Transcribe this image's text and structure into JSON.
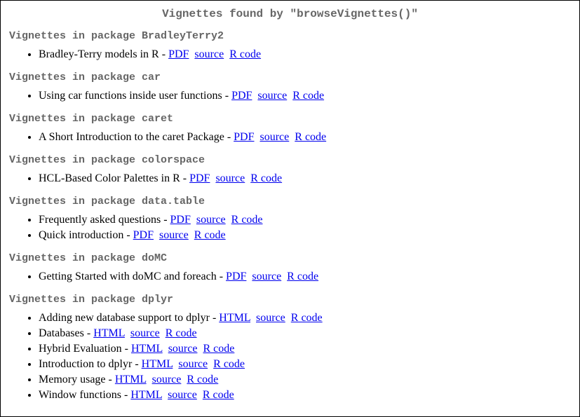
{
  "title": "Vignettes found by \"browseVignettes()\"",
  "heading_prefix": "Vignettes in package ",
  "dash": " - ",
  "link_spacer": "  ",
  "packages": [
    {
      "name": "BradleyTerry2",
      "vignettes": [
        {
          "title": "Bradley-Terry models in R",
          "links": [
            "PDF",
            "source",
            "R code"
          ]
        }
      ]
    },
    {
      "name": "car",
      "vignettes": [
        {
          "title": "Using car functions inside user functions",
          "links": [
            "PDF",
            "source",
            "R code"
          ]
        }
      ]
    },
    {
      "name": "caret",
      "vignettes": [
        {
          "title": "A Short Introduction to the caret Package",
          "links": [
            "PDF",
            "source",
            "R code"
          ]
        }
      ]
    },
    {
      "name": "colorspace",
      "vignettes": [
        {
          "title": "HCL-Based Color Palettes in R",
          "links": [
            "PDF",
            "source",
            "R code"
          ]
        }
      ]
    },
    {
      "name": "data.table",
      "vignettes": [
        {
          "title": "Frequently asked questions",
          "links": [
            "PDF",
            "source",
            "R code"
          ]
        },
        {
          "title": "Quick introduction",
          "links": [
            "PDF",
            "source",
            "R code"
          ]
        }
      ]
    },
    {
      "name": "doMC",
      "vignettes": [
        {
          "title": "Getting Started with doMC and foreach",
          "links": [
            "PDF",
            "source",
            "R code"
          ]
        }
      ]
    },
    {
      "name": "dplyr",
      "vignettes": [
        {
          "title": "Adding new database support to dplyr",
          "links": [
            "HTML",
            "source",
            "R code"
          ]
        },
        {
          "title": "Databases",
          "links": [
            "HTML",
            "source",
            "R code"
          ]
        },
        {
          "title": "Hybrid Evaluation",
          "links": [
            "HTML",
            "source",
            "R code"
          ]
        },
        {
          "title": "Introduction to dplyr",
          "links": [
            "HTML",
            "source",
            "R code"
          ]
        },
        {
          "title": "Memory usage",
          "links": [
            "HTML",
            "source",
            "R code"
          ]
        },
        {
          "title": "Window functions",
          "links": [
            "HTML",
            "source",
            "R code"
          ]
        }
      ]
    }
  ]
}
